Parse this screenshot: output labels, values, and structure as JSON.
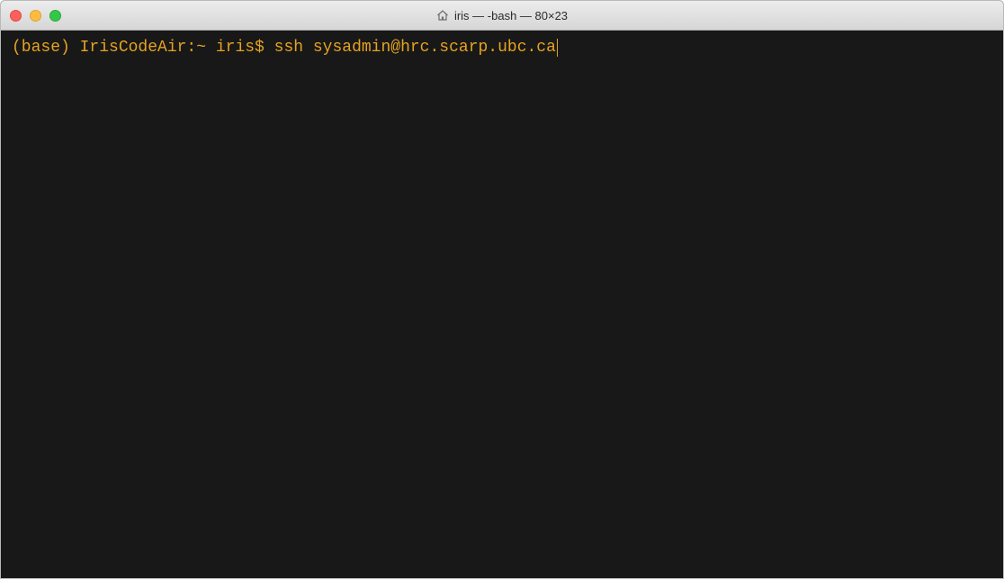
{
  "window": {
    "title": "iris — -bash — 80×23",
    "title_icon": "home-icon"
  },
  "terminal": {
    "prompt": "(base) IrisCodeAir:~ iris$ ",
    "command": "ssh sysadmin@hrc.scarp.ubc.ca"
  },
  "colors": {
    "terminal_background": "#181818",
    "terminal_text": "#e5a321",
    "close": "#fc605b",
    "minimize": "#fdbc40",
    "maximize": "#34c84a"
  }
}
